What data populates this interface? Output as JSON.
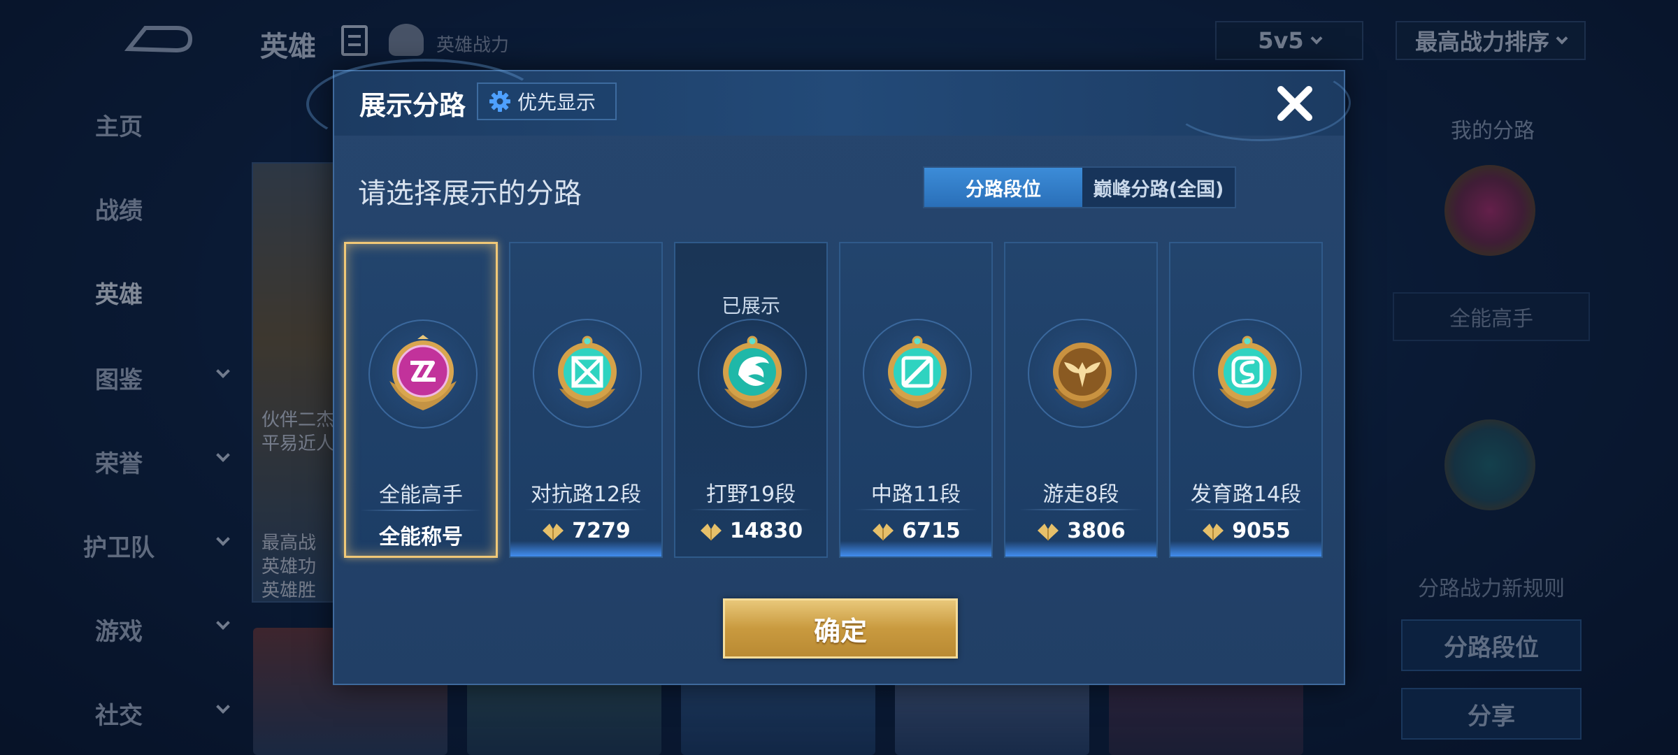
{
  "top_bar": {
    "title": "英雄",
    "subtitle": "英雄战力",
    "mode_select": "5v5",
    "sort_select": "最高战力排序"
  },
  "sidebar": {
    "items": [
      {
        "label": "主页"
      },
      {
        "label": "战绩"
      },
      {
        "label": "英雄"
      },
      {
        "label": "图鉴"
      },
      {
        "label": "荣誉"
      },
      {
        "label": "护卫队"
      },
      {
        "label": "游戏"
      },
      {
        "label": "社交"
      }
    ]
  },
  "background_card": {
    "lines": [
      "最高战",
      "英雄功",
      "英雄胜"
    ],
    "overlay_lines": [
      "伙伴二杰",
      "平易近人"
    ]
  },
  "right_panel": {
    "title": "我的分路",
    "medal_label": "全能高手",
    "rule_label": "分路战力新规则",
    "lane_rank_button": "分路段位",
    "share_button": "分享"
  },
  "modal": {
    "title": "展示分路",
    "priority_button": "优先显示",
    "prompt": "请选择展示的分路",
    "tabs": [
      {
        "label": "分路段位",
        "active": true
      },
      {
        "label": "巅峰分路(全国)",
        "active": false
      }
    ],
    "cards": [
      {
        "name": "全能高手",
        "value": "全能称号",
        "selected": true,
        "shown_label": "",
        "medal": "allround-medal-icon"
      },
      {
        "name": "对抗路12段",
        "value": "7279",
        "selected": false,
        "shown_label": "",
        "medal": "clash-lane-medal-icon"
      },
      {
        "name": "打野19段",
        "value": "14830",
        "selected": false,
        "shown_label": "已展示",
        "medal": "jungle-medal-icon"
      },
      {
        "name": "中路11段",
        "value": "6715",
        "selected": false,
        "shown_label": "",
        "medal": "mid-lane-medal-icon"
      },
      {
        "name": "游走8段",
        "value": "3806",
        "selected": false,
        "shown_label": "",
        "medal": "roam-medal-icon"
      },
      {
        "name": "发育路14段",
        "value": "9055",
        "selected": false,
        "shown_label": "",
        "medal": "farm-lane-medal-icon"
      }
    ],
    "confirm_button": "确定"
  },
  "colors": {
    "accent_blue": "#2a6fb8",
    "gold": "#c99a3f",
    "selected_border": "#f0c877",
    "medal_magenta": "#c2329b",
    "medal_teal": "#2fd3c0",
    "medal_gold": "#d49a45"
  }
}
